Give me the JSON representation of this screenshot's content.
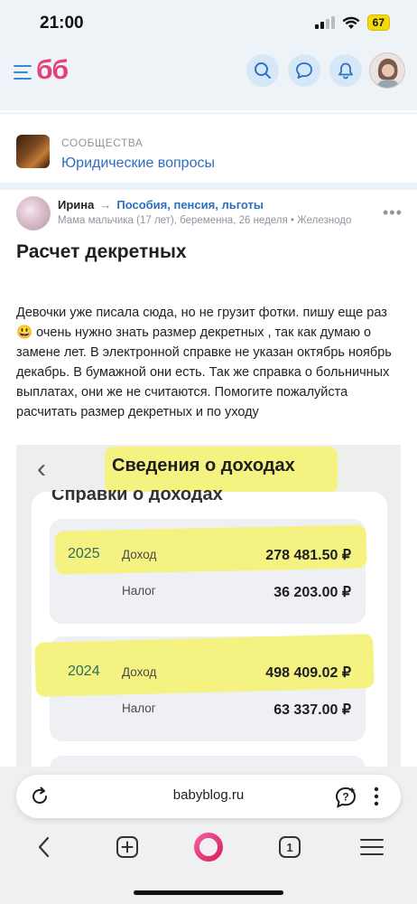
{
  "status_bar": {
    "time": "21:00",
    "battery": "67"
  },
  "header": {
    "logo": "бб",
    "icons": [
      "menu-icon",
      "search-icon",
      "chat-icon",
      "bell-icon",
      "profile-avatar"
    ]
  },
  "community": {
    "kicker": "СООБЩЕСТВА",
    "name": "Юридические вопросы"
  },
  "post": {
    "author": "Ирина",
    "arrow": "→",
    "topic": "Пособия, пенсия, льготы",
    "meta": "Мама мальчика (17 лет), беременна, 26 неделя  •  Железнодо",
    "more": "⋮",
    "title": "Расчет декретных",
    "body_part1": "Девочки уже писала сюда, но не грузит фотки. пишу еще раз",
    "emoji": "😃",
    "body_part2": " очень нужно знать размер декретных , так как думаю о замене лет. В электронной справке не указан октябрь ноябрь декабрь. В бумажной они есть. Так же справка о больничных выплатах, они же не считаются. Помогите пожалуйста расчитать размер декретных и по уходу"
  },
  "embedded_image": {
    "back": "‹",
    "title": "Сведения о доходах",
    "clipped_heading": "Справки о доходах",
    "records": [
      {
        "year": "2025",
        "income_label": "Доход",
        "income": "278 481.50 ₽",
        "tax_label": "Налог",
        "tax": "36 203.00 ₽"
      },
      {
        "year": "2024",
        "income_label": "Доход",
        "income": "498 409.02 ₽",
        "tax_label": "Налог",
        "tax": "63 337.00 ₽"
      }
    ],
    "highlight_color": "#f3f27a"
  },
  "browser": {
    "url": "babyblog.ru",
    "tab_count": "1"
  },
  "colors": {
    "accent_blue": "#2d6fc2",
    "brand_pink": "#e83e7a",
    "header_bg": "#eef3f8"
  }
}
